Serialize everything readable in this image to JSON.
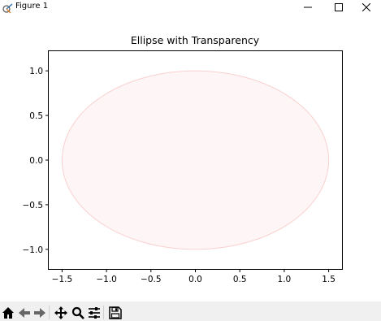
{
  "window": {
    "title": "Figure 1",
    "app_icon": "matplotlib-figure-icon",
    "controls": [
      "minimize-icon",
      "maximize-icon",
      "close-icon"
    ]
  },
  "toolbar": {
    "buttons": [
      {
        "name": "home-button",
        "icon": "home-icon"
      },
      {
        "name": "back-button",
        "icon": "arrow-left-icon"
      },
      {
        "name": "forward-button",
        "icon": "arrow-right-icon"
      },
      {
        "name": "pan-button",
        "icon": "move-icon"
      },
      {
        "name": "zoom-button",
        "icon": "magnifier-icon"
      },
      {
        "name": "configure-subplots-button",
        "icon": "sliders-icon"
      },
      {
        "name": "save-button",
        "icon": "floppy-disk-icon"
      }
    ]
  },
  "chart_data": {
    "type": "ellipse",
    "title": "Ellipse with Transparency",
    "xlabel": "",
    "ylabel": "",
    "xlim": [
      -1.65,
      1.65
    ],
    "ylim": [
      -1.22,
      1.22
    ],
    "xticks": [
      -1.5,
      -1.0,
      -0.5,
      0.0,
      0.5,
      1.0,
      1.5
    ],
    "xtick_labels": [
      "−1.5",
      "−1.0",
      "−0.5",
      "0.0",
      "0.5",
      "1.0",
      "1.5"
    ],
    "yticks": [
      -1.0,
      -0.5,
      0.0,
      0.5,
      1.0
    ],
    "ytick_labels": [
      "−1.0",
      "−0.5",
      "0.0",
      "0.5",
      "1.0"
    ],
    "grid": false,
    "ellipse": {
      "center": [
        0,
        0
      ],
      "width": 3,
      "height": 2,
      "facecolor": "#f4a3a3",
      "edgecolor": "#f08080",
      "alpha": 0.1
    }
  }
}
